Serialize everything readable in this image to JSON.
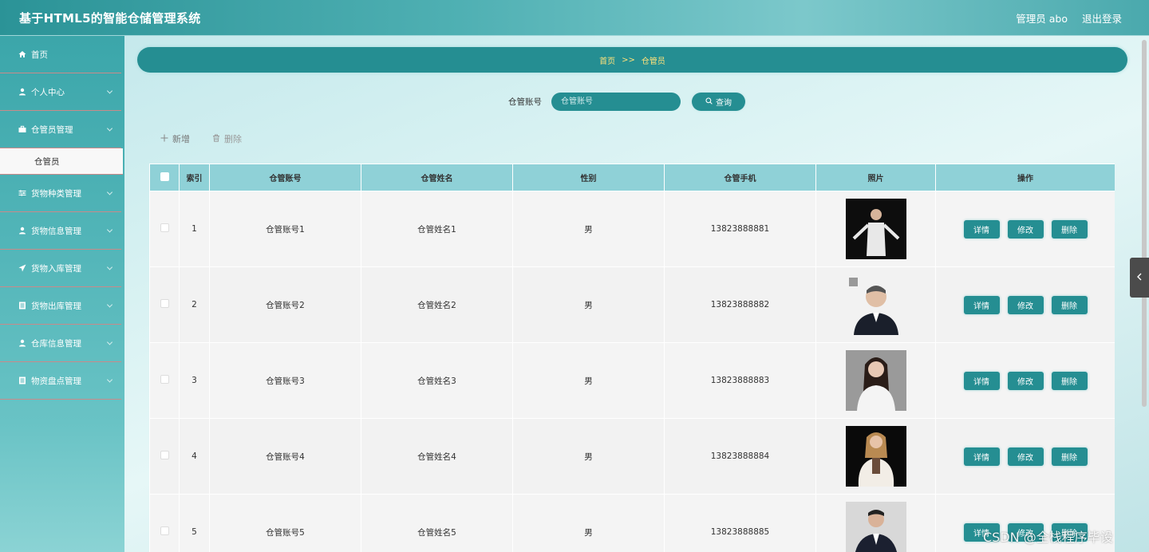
{
  "header": {
    "title": "基于HTML5的智能仓储管理系统",
    "user_label": "管理员 abo",
    "logout_label": "退出登录"
  },
  "sidebar": {
    "items": [
      {
        "label": "首页",
        "icon": "home-icon",
        "expandable": false
      },
      {
        "label": "个人中心",
        "icon": "user-icon",
        "expandable": true
      },
      {
        "label": "仓管员管理",
        "icon": "briefcase-icon",
        "expandable": true,
        "children": [
          "仓管员"
        ]
      },
      {
        "label": "货物种类管理",
        "icon": "sliders-icon",
        "expandable": true
      },
      {
        "label": "货物信息管理",
        "icon": "user-icon",
        "expandable": true
      },
      {
        "label": "货物入库管理",
        "icon": "send-icon",
        "expandable": true
      },
      {
        "label": "货物出库管理",
        "icon": "list-icon",
        "expandable": true
      },
      {
        "label": "仓库信息管理",
        "icon": "user-icon",
        "expandable": true
      },
      {
        "label": "物资盘点管理",
        "icon": "list-icon",
        "expandable": true
      }
    ]
  },
  "breadcrumb": {
    "home": "首页",
    "separator": ">>",
    "current": "仓管员"
  },
  "search": {
    "label": "仓管账号",
    "placeholder": "仓管账号",
    "button_label": "查询"
  },
  "actions": {
    "add_label": "新增",
    "delete_label": "删除"
  },
  "table": {
    "columns": [
      "索引",
      "仓管账号",
      "仓管姓名",
      "性别",
      "仓管手机",
      "照片",
      "操作"
    ],
    "rows": [
      {
        "index": "1",
        "account": "仓管账号1",
        "name": "仓管姓名1",
        "gender": "男",
        "phone": "13823888881"
      },
      {
        "index": "2",
        "account": "仓管账号2",
        "name": "仓管姓名2",
        "gender": "男",
        "phone": "13823888882"
      },
      {
        "index": "3",
        "account": "仓管账号3",
        "name": "仓管姓名3",
        "gender": "男",
        "phone": "13823888883"
      },
      {
        "index": "4",
        "account": "仓管账号4",
        "name": "仓管姓名4",
        "gender": "男",
        "phone": "13823888884"
      },
      {
        "index": "5",
        "account": "仓管账号5",
        "name": "仓管姓名5",
        "gender": "男",
        "phone": "13823888885"
      }
    ],
    "row_buttons": {
      "detail": "详情",
      "edit": "修改",
      "delete": "删除"
    }
  },
  "watermark": "CSDN @全栈程序毕设",
  "colors": {
    "accent": "#258e92",
    "breadcrumb_text": "#ffe27a",
    "header_row": "#8fd1d7"
  }
}
